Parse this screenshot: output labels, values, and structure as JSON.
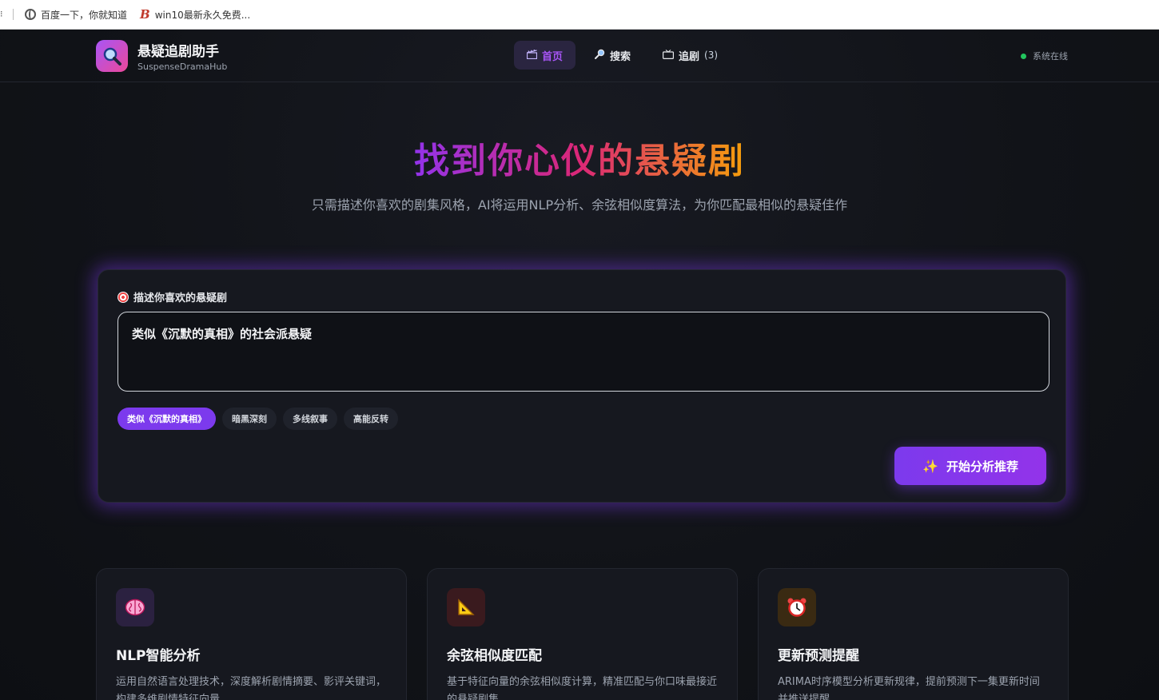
{
  "browser": {
    "bookmarks": [
      {
        "label": "百度一下，你就知道",
        "icon": "globe-icon"
      },
      {
        "label": "win10最新永久免费...",
        "icon": "b-logo-icon"
      }
    ]
  },
  "header": {
    "brand_title": "悬疑追剧助手",
    "brand_subtitle": "SuspenseDramaHub",
    "nav": [
      {
        "label": "首页",
        "icon": "clapperboard-icon",
        "active": true
      },
      {
        "label": "搜索",
        "icon": "magnifier-icon",
        "active": false
      },
      {
        "label": "追剧",
        "count": "(3)",
        "icon": "tv-icon",
        "active": false
      }
    ],
    "status": "系统在线"
  },
  "hero": {
    "title": "找到你心仪的悬疑剧",
    "subtitle": "只需描述你喜欢的剧集风格，AI将运用NLP分析、余弦相似度算法，为你匹配最相似的悬疑佳作"
  },
  "search": {
    "label": "描述你喜欢的悬疑剧",
    "value": "类似《沉默的真相》的社会派悬疑",
    "tags": [
      {
        "label": "类似《沉默的真相》",
        "active": true
      },
      {
        "label": "暗黑深刻",
        "active": false
      },
      {
        "label": "多线叙事",
        "active": false
      },
      {
        "label": "高能反转",
        "active": false
      }
    ],
    "submit_label": "开始分析推荐"
  },
  "features": [
    {
      "title": "NLP智能分析",
      "desc": "运用自然语言处理技术，深度解析剧情摘要、影评关键词，构建多维剧情特征向量",
      "icon": "brain-icon"
    },
    {
      "title": "余弦相似度匹配",
      "desc": "基于特征向量的余弦相似度计算，精准匹配与你口味最接近的悬疑剧集",
      "icon": "triangle-ruler-icon"
    },
    {
      "title": "更新预测提醒",
      "desc": "ARIMA时序模型分析更新规律，提前预测下一集更新时间并推送提醒",
      "icon": "alarm-clock-icon"
    }
  ],
  "colors": {
    "accent": "#7c3aed",
    "background": "#0f1116",
    "status_online": "#22c55e"
  }
}
